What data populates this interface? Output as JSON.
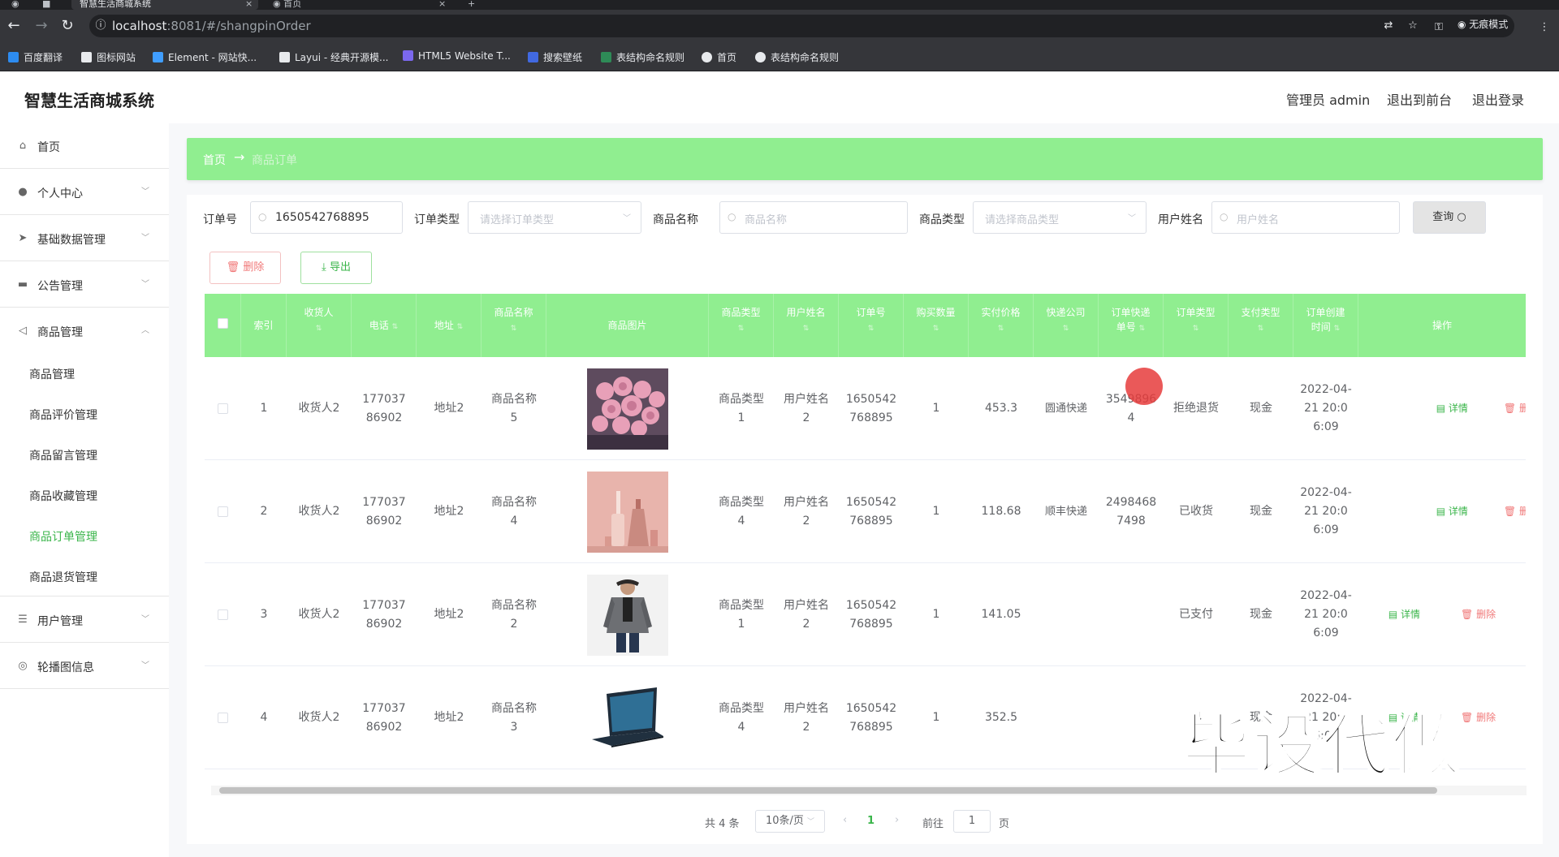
{
  "browser": {
    "tabs": [
      {
        "title": "智慧生活商城系统",
        "active": true
      },
      {
        "title": "首页",
        "active": false
      }
    ],
    "url_host": "localhost",
    "url_rest": ":8081/#/shangpinOrder",
    "incognito_label": "无痕模式",
    "bookmarks": [
      {
        "label": "百度翻译",
        "color": "#2d8cf0"
      },
      {
        "label": "图标网站",
        "color": "#e8eaed"
      },
      {
        "label": "Element - 网站快...",
        "color": "#409eff"
      },
      {
        "label": "Layui - 经典开源模...",
        "color": "#e8eaed"
      },
      {
        "label": "HTML5 Website T...",
        "color": "#7b68ee"
      },
      {
        "label": "搜索壁纸",
        "color": "#4169e1"
      },
      {
        "label": "表结构命名规则",
        "color": "#2e8b57"
      },
      {
        "label": "首页",
        "color": "#e8eaed"
      },
      {
        "label": "表结构命名规则",
        "color": "#e8eaed"
      }
    ]
  },
  "header": {
    "title": "智慧生活商城系统",
    "admin": "管理员 admin",
    "to_front": "退出到前台",
    "logout": "退出登录"
  },
  "sidebar": {
    "items": [
      {
        "label": "首页",
        "icon": "home-icon"
      },
      {
        "label": "个人中心",
        "icon": "user-icon"
      },
      {
        "label": "基础数据管理",
        "icon": "send-icon"
      },
      {
        "label": "公告管理",
        "icon": "message-icon"
      },
      {
        "label": "商品管理",
        "icon": "navigation-icon"
      }
    ],
    "sub_items": [
      "商品管理",
      "商品评价管理",
      "商品留言管理",
      "商品收藏管理",
      "商品订单管理",
      "商品退货管理"
    ],
    "bottom_items": [
      {
        "label": "用户管理",
        "icon": "sliders-icon"
      },
      {
        "label": "轮播图信息",
        "icon": "compass-icon"
      }
    ]
  },
  "breadcrumb": {
    "home": "首页",
    "sep": "→",
    "current": "商品订单"
  },
  "filters": {
    "order_no_label": "订单号",
    "order_no_value": "1650542768895",
    "order_type_label": "订单类型",
    "order_type_placeholder": "请选择订单类型",
    "product_name_label": "商品名称",
    "product_name_placeholder": "商品名称",
    "product_type_label": "商品类型",
    "product_type_placeholder": "请选择商品类型",
    "user_name_label": "用户姓名",
    "user_name_placeholder": "用户姓名",
    "query_button": "查询"
  },
  "actions": {
    "delete": "删除",
    "export": "导出"
  },
  "table": {
    "headers": [
      "",
      "索引",
      "收货人",
      "电话",
      "地址",
      "商品名称",
      "商品图片",
      "商品类型",
      "用户姓名",
      "订单号",
      "购买数量",
      "实付价格",
      "快递公司",
      "订单快递单号",
      "订单类型",
      "支付类型",
      "订单创建时间",
      "操作"
    ],
    "rows": [
      {
        "index": "1",
        "receiver": "收货人2",
        "phone": "17703786902",
        "address": "地址2",
        "product": "商品名称5",
        "image": "roses",
        "ptype": "商品类型1",
        "user": "用户姓名2",
        "order_no": "1650542768895",
        "qty": "1",
        "price": "453.3",
        "courier": "圆通快递",
        "tracking": "35498964",
        "otype": "拒绝退货",
        "pay": "现金",
        "created": "2022-04-21 20:06:09",
        "detail": "详情",
        "del": "删除"
      },
      {
        "index": "2",
        "receiver": "收货人2",
        "phone": "17703786902",
        "address": "地址2",
        "product": "商品名称4",
        "image": "perfume",
        "ptype": "商品类型4",
        "user": "用户姓名2",
        "order_no": "1650542768895",
        "qty": "1",
        "price": "118.68",
        "courier": "顺丰快递",
        "tracking": "24984687498",
        "otype": "已收货",
        "pay": "现金",
        "created": "2022-04-21 20:06:09",
        "detail": "详情",
        "del": "删除"
      },
      {
        "index": "3",
        "receiver": "收货人2",
        "phone": "17703786902",
        "address": "地址2",
        "product": "商品名称2",
        "image": "jacket",
        "ptype": "商品类型1",
        "user": "用户姓名2",
        "order_no": "1650542768895",
        "qty": "1",
        "price": "141.05",
        "courier": "",
        "tracking": "",
        "otype": "已支付",
        "pay": "现金",
        "created": "2022-04-21 20:06:09",
        "detail": "详情",
        "del": "删除"
      },
      {
        "index": "4",
        "receiver": "收货人2",
        "phone": "17703786902",
        "address": "地址2",
        "product": "商品名称3",
        "image": "laptop",
        "ptype": "商品类型4",
        "user": "用户姓名2",
        "order_no": "1650542768895",
        "qty": "1",
        "price": "352.5",
        "courier": "",
        "tracking": "",
        "otype": "已",
        "pay": "现金",
        "created": "2022-04-21 20:06:09",
        "detail": "详情",
        "del": "删除"
      }
    ]
  },
  "pagination": {
    "total": "共 4 条",
    "page_size": "10条/页",
    "current": "1",
    "goto_label": "前往",
    "goto_value": "1",
    "page_unit": "页"
  },
  "watermark": "毕设代做",
  "colors": {
    "accent": "#90ee90",
    "active_text": "#3ab54a",
    "danger": "#f07878"
  }
}
